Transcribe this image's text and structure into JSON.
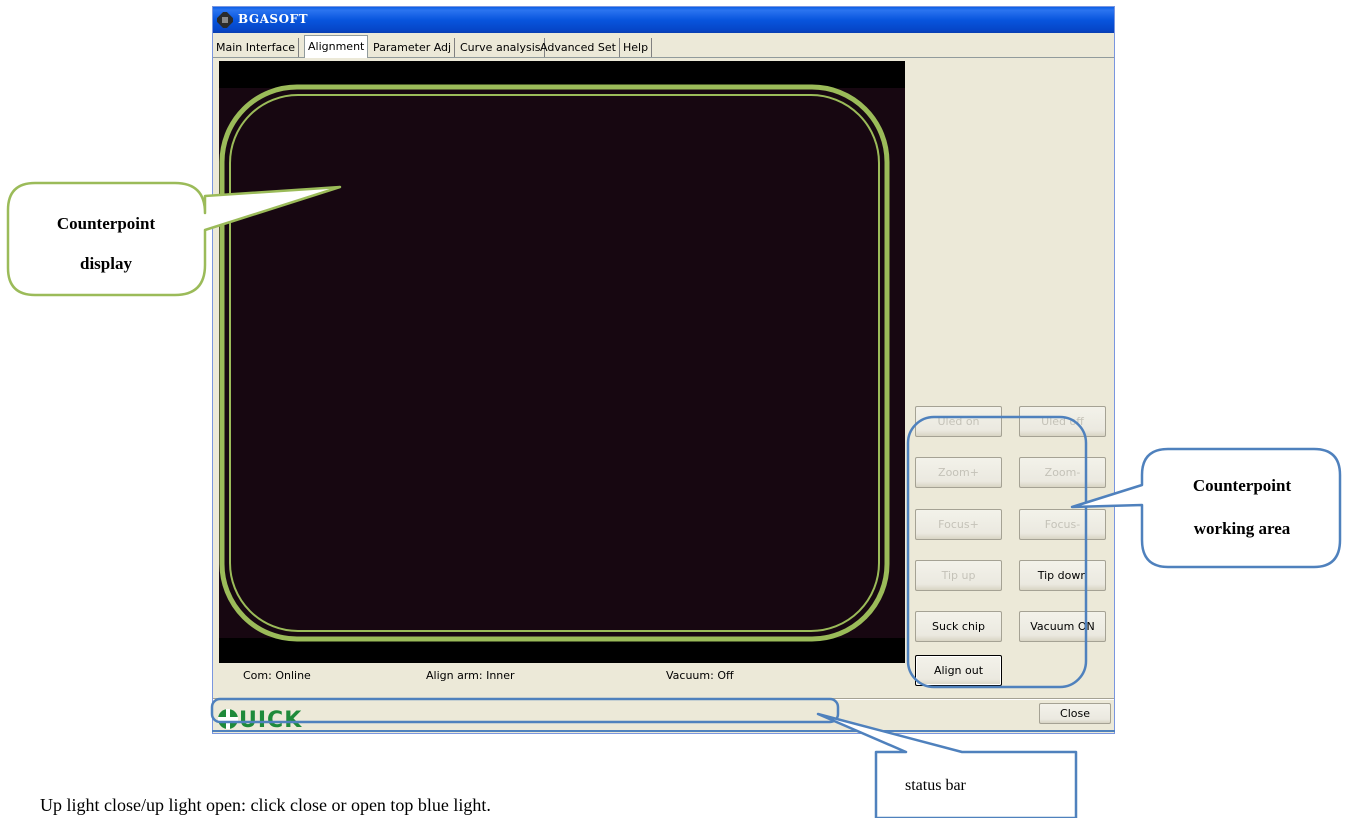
{
  "window": {
    "title": "BGASOFT",
    "tabs": [
      "Main Interface",
      "Alignment",
      "Parameter Adj",
      "Curve analysis",
      "Advanced Set",
      "Help"
    ],
    "active_tab_index": 1
  },
  "status": {
    "com": "Com: Online",
    "align_arm": "Align arm: Inner",
    "vacuum": "Vacuum: Off"
  },
  "buttons": {
    "uled_on": "Uled on",
    "uled_off": "Uled off",
    "zoom_plus": "Zoom+",
    "zoom_minus": "Zoom-",
    "focus_plus": "Focus+",
    "focus_minus": "Focus-",
    "tip_up": "Tip up",
    "tip_down": "Tip down",
    "suck_chip": "Suck chip",
    "vacuum_on": "Vacuum ON",
    "align_out": "Align out",
    "close": "Close"
  },
  "logo_text": "UICK",
  "annotations": {
    "display_line1": "Counterpoint",
    "display_line2": "display",
    "working_line1": "Counterpoint",
    "working_line2": "working area",
    "status_bar": "status bar"
  },
  "caption": "Up light close/up light open: click close or open top blue light.",
  "colors": {
    "highlight_green": "#9bbb59",
    "annotation_blue": "#4f81bd",
    "title_blue": "#0a5fe6",
    "logo_green": "#1e8a3a"
  }
}
